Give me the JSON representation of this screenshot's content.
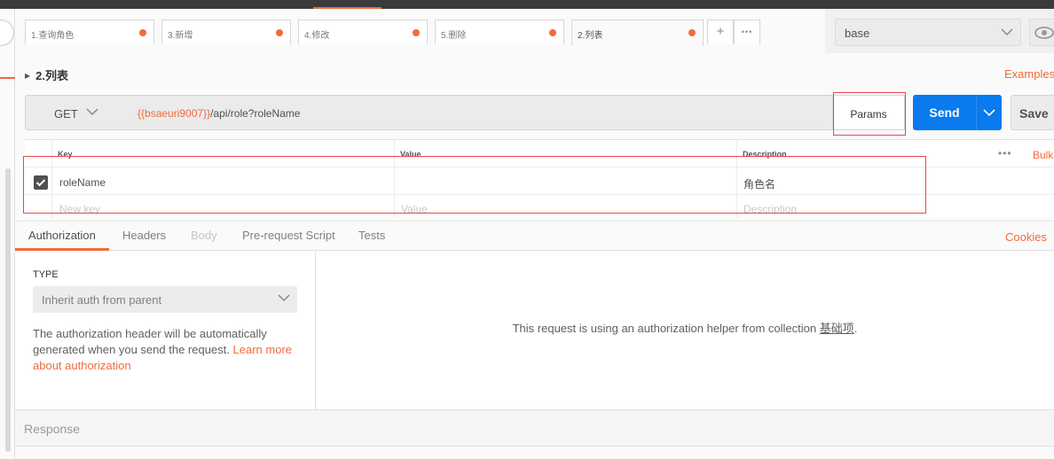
{
  "tabs": [
    {
      "label": "1.查询角色"
    },
    {
      "label": "3.新增"
    },
    {
      "label": "4.修改"
    },
    {
      "label": "5.删除"
    },
    {
      "label": "2.列表"
    }
  ],
  "tab_add_label": "+",
  "tab_more_label": "•••",
  "environment": {
    "selected": "base"
  },
  "request": {
    "name": "2.列表",
    "examples_label": "Examples",
    "method": "GET",
    "url_variable": "{{bsaeuri9007}}",
    "url_path": "/api/role?roleName",
    "params_label": "Params",
    "send_label": "Send",
    "save_label": "Save"
  },
  "params": {
    "headers": {
      "key": "Key",
      "value": "Value",
      "description": "Description"
    },
    "rows": [
      {
        "key": "roleName",
        "value": "",
        "description": "角色名",
        "checked": true
      }
    ],
    "placeholders": {
      "key": "New key",
      "value": "Value",
      "description": "Description"
    },
    "more_label": "•••",
    "bulk_label": "Bulk"
  },
  "subtabs": [
    {
      "label": "Authorization",
      "active": true
    },
    {
      "label": "Headers"
    },
    {
      "label": "Body",
      "disabled": true
    },
    {
      "label": "Pre-request Script"
    },
    {
      "label": "Tests"
    }
  ],
  "cookies_label": "Cookies",
  "auth": {
    "type_label": "TYPE",
    "type_value": "Inherit auth from parent",
    "description": "The authorization header will be automatically generated when you send the request.",
    "learn_more": "Learn more about authorization",
    "helper_text": "This request is using an authorization helper from collection",
    "collection_name": "基础项",
    "helper_end": "."
  },
  "response_label": "Response",
  "colors": {
    "accent": "#f26b3a",
    "send": "#097bed",
    "annotation": "#e8484e"
  }
}
